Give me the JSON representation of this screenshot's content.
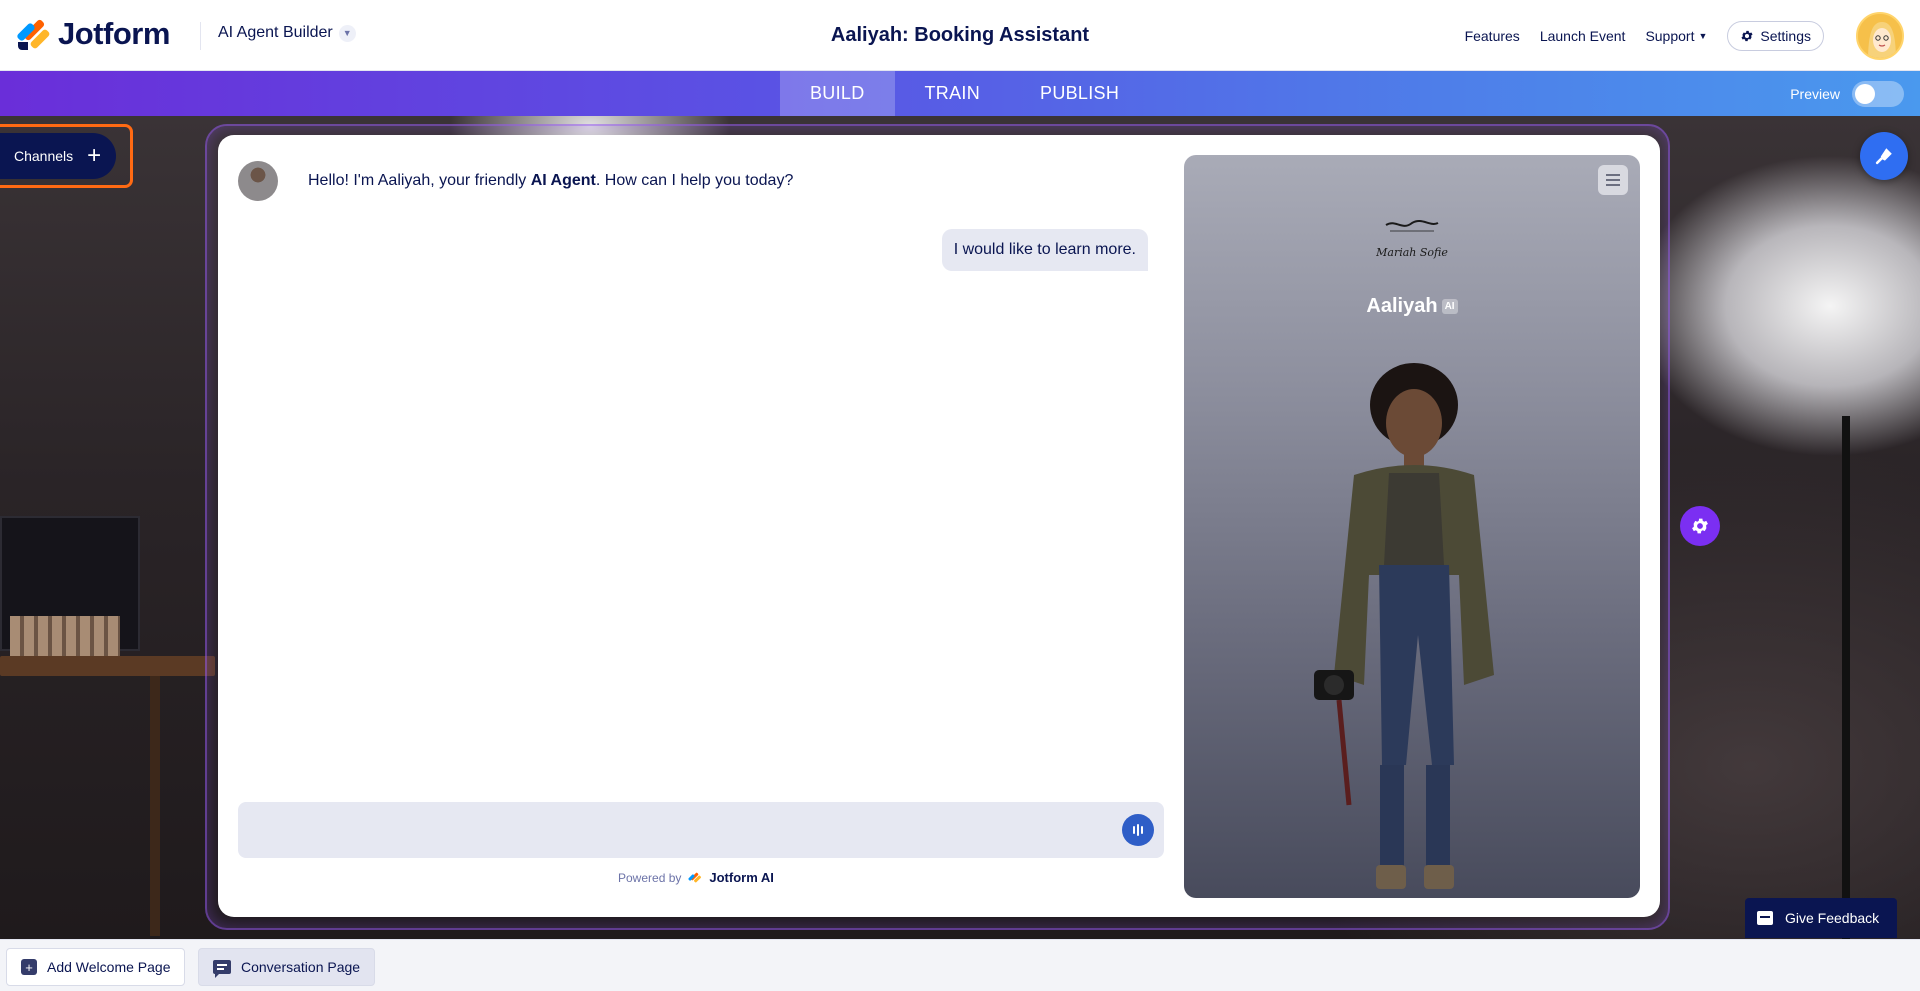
{
  "header": {
    "brand": "Jotform",
    "builder_label": "AI Agent Builder",
    "title": "Aaliyah: Booking Assistant",
    "nav": {
      "features": "Features",
      "launch_event": "Launch Event",
      "support": "Support",
      "settings": "Settings"
    }
  },
  "tabs": {
    "build": "BUILD",
    "train": "TRAIN",
    "publish": "PUBLISH",
    "active": "BUILD"
  },
  "preview": {
    "label": "Preview",
    "enabled": false
  },
  "channels": {
    "label": "Channels",
    "plus": "+"
  },
  "chat": {
    "agent_message_before": "Hello! I'm Aaliyah, your friendly ",
    "agent_message_bold": "AI Agent",
    "agent_message_after": ". How can I help you today?",
    "user_message": "I would like to learn more.",
    "input_value": "",
    "powered_by": "Powered by",
    "powered_brand": "Jotform AI"
  },
  "agent_panel": {
    "brand_signature": "Mariah Sofie",
    "name": "Aaliyah",
    "badge": "AI"
  },
  "bottom_bar": {
    "add_welcome_page": "Add Welcome Page",
    "conversation_page": "Conversation Page"
  },
  "feedback": {
    "label": "Give Feedback"
  },
  "colors": {
    "navy": "#0a1551",
    "orange": "#ff6a13",
    "tab_gradient_start": "#6a2ed9",
    "tab_gradient_end": "#4a99ee",
    "paint_button": "#2f6ef2",
    "gear_button": "#7b2ff2"
  }
}
